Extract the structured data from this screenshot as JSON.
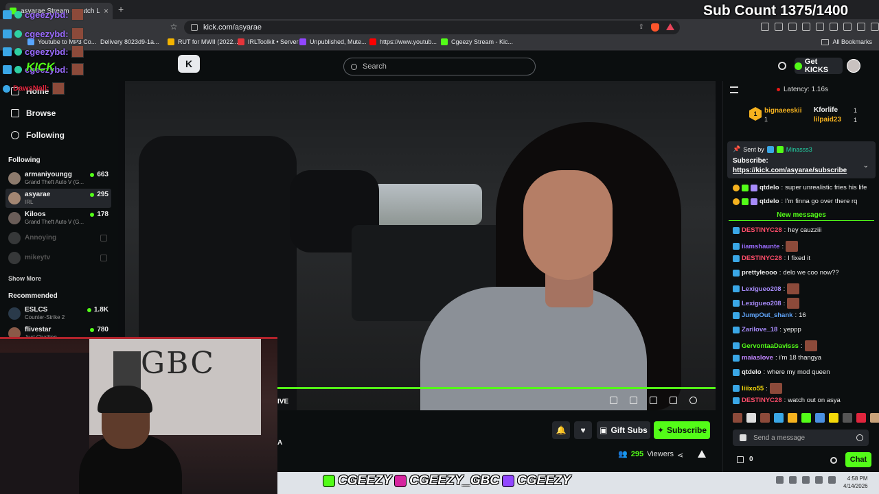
{
  "browser": {
    "tab_title": "asyarae Stream - Watch Live",
    "url": "kick.com/asyarae",
    "bookmarks": [
      "Youtube to MP3 Co...",
      "Delivery 8023d9-1a...",
      "RUT for MWII (2022...",
      "IRLToolkit • Server",
      "Unpublished, Mute...",
      "https://www.youtub...",
      "Cgeezy Stream - Kic..."
    ],
    "all_bookmarks": "All Bookmarks"
  },
  "header": {
    "search_placeholder": "Search",
    "get_kicks": "Get KICKS"
  },
  "sidebar": {
    "nav": [
      "Home",
      "Browse",
      "Following"
    ],
    "following_heading": "Following",
    "following": [
      {
        "name": "armaniyoungg",
        "game": "Grand Theft Auto V (G...",
        "viewers": "663"
      },
      {
        "name": "asyarae",
        "game": "IRL",
        "viewers": "295"
      },
      {
        "name": "Kiloos",
        "game": "Grand Theft Auto V (G...",
        "viewers": "178"
      },
      {
        "name": "Annoying",
        "game": "",
        "viewers": ""
      },
      {
        "name": "mikeytv",
        "game": "",
        "viewers": ""
      }
    ],
    "show_more": "Show More",
    "recommended_heading": "Recommended",
    "recommended": [
      {
        "name": "ESLCS",
        "game": "Counter-Strike 2",
        "viewers": "1.8K"
      },
      {
        "name": "flivestar",
        "game": "Just Chatting",
        "viewers": "780"
      }
    ]
  },
  "video": {
    "live_label": "IVE"
  },
  "below_video": {
    "gift_subs": "Gift Subs",
    "subscribe": "Subscribe",
    "viewers_count": "295",
    "viewers_label": "Viewers",
    "stub": "A"
  },
  "chat": {
    "latency": "Latency: 1.16s",
    "leaderboard": [
      {
        "name": "bignaeeskii",
        "count": "1"
      },
      {
        "name": "Kforlife",
        "count": "1"
      },
      {
        "name": "lilpaid23",
        "count": "1"
      }
    ],
    "pinned": {
      "sent_by_label": "Sent by",
      "sent_by_user": "Minasss3",
      "title": "Subscribe:",
      "link": "https://kick.com/asyarae/subscribe"
    },
    "messages_before": [
      {
        "user": "qtdelo",
        "text": "super unrealistic fries his life",
        "color": "#eee"
      },
      {
        "user": "qtdelo",
        "text": "I'm finna go over there rq",
        "color": "#eee"
      }
    ],
    "new_messages_label": "New messages",
    "messages": [
      {
        "user": "DESTINYC28",
        "text": "hey cauzziii",
        "color": "#ff4d6a"
      },
      {
        "user": "iiamshaunte",
        "text": "",
        "color": "#9b6cff"
      },
      {
        "user": "DESTINYC28",
        "text": "I fixed it",
        "color": "#ff4d6a"
      },
      {
        "user": "prettyleooo",
        "text": "delo we coo now??",
        "color": "#eee"
      },
      {
        "user": "Lexigueo208",
        "text": "",
        "color": "#a78bfa"
      },
      {
        "user": "Lexigueo208",
        "text": "",
        "color": "#a78bfa"
      },
      {
        "user": "JumpOut_shank",
        "text": "16",
        "color": "#60a5fa"
      },
      {
        "user": "Zarilove_18",
        "text": "yeppp",
        "color": "#a78bfa"
      },
      {
        "user": "GervontaaDavisss",
        "text": "",
        "color": "#53fc18"
      },
      {
        "user": "maiaslove",
        "text": "i'm 18 thangya",
        "color": "#c084fc"
      },
      {
        "user": "qtdelo",
        "text": "where my mod queen",
        "color": "#eee"
      },
      {
        "user": "liiixo55",
        "text": "",
        "color": "#f5d90a"
      },
      {
        "user": "DESTINYC28",
        "text": "watch out on asya",
        "color": "#ff4d6a"
      }
    ],
    "input_placeholder": "Send a message",
    "kicks_count": "0",
    "chat_button": "Chat"
  },
  "overlay": {
    "sub_count": "Sub Count 1375/1400",
    "feed_user": "cgeezybd:",
    "feed_user2": "DawsNall:",
    "kick_tag": "KICK",
    "socials": [
      "CGEEZY",
      "CGEEZY_GBC",
      "CGEEZY"
    ],
    "webcam_sign": "GBC"
  },
  "taskbar": {
    "time": "4:58 PM",
    "date": "4/14/2026"
  },
  "colors": {
    "kick_green": "#53fc18",
    "background": "#0b0e0f",
    "panel": "#24272c"
  }
}
